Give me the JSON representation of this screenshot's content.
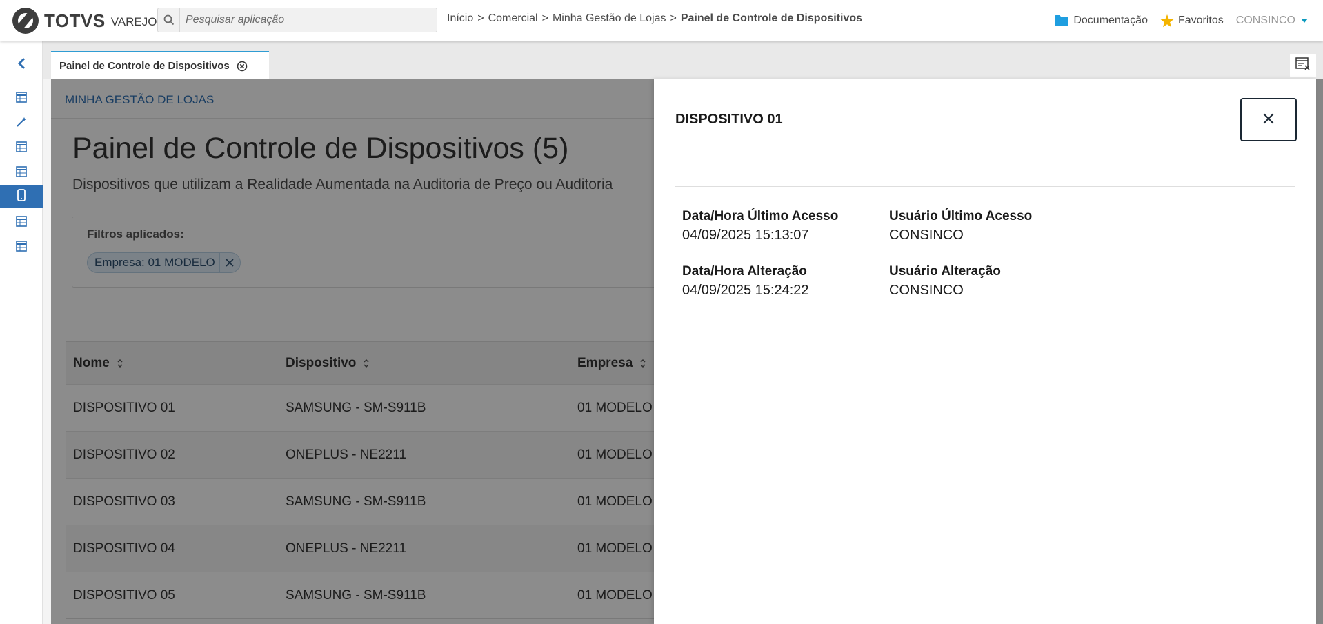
{
  "header": {
    "brand": "TOTVS",
    "product": "VAREJO",
    "search_placeholder": "Pesquisar aplicação",
    "breadcrumb": [
      "Início",
      "Comercial",
      "Minha Gestão de Lojas",
      "Painel de Controle de Dispositivos"
    ],
    "breadcrumb_separator": ">",
    "documentation_label": "Documentação",
    "favorites_label": "Favoritos",
    "user_label": "CONSINCO"
  },
  "sidebar": {
    "items": [
      {
        "icon": "chevron-left-icon"
      },
      {
        "icon": "table-icon"
      },
      {
        "icon": "wand-icon"
      },
      {
        "icon": "table-icon"
      },
      {
        "icon": "table-icon"
      },
      {
        "icon": "mobile-icon",
        "active": true
      },
      {
        "icon": "table-icon"
      },
      {
        "icon": "table-icon"
      }
    ]
  },
  "tabs": [
    {
      "label": "Painel de Controle de Dispositivos",
      "active": true
    }
  ],
  "page": {
    "section": "MINHA GESTÃO DE LOJAS",
    "title": "Painel de Controle de Dispositivos (5)",
    "subtitle": "Dispositivos que utilizam a Realidade Aumentada na Auditoria de Preço ou Auditoria",
    "filters_title": "Filtros aplicados:",
    "filter_chip": "Empresa: 01 MODELO"
  },
  "table": {
    "columns": [
      "Nome",
      "Dispositivo",
      "Empresa"
    ],
    "rows": [
      [
        "DISPOSITIVO 01",
        "SAMSUNG - SM-S911B",
        "01 MODELO"
      ],
      [
        "DISPOSITIVO 02",
        "ONEPLUS - NE2211",
        "01 MODELO"
      ],
      [
        "DISPOSITIVO 03",
        "SAMSUNG - SM-S911B",
        "01 MODELO"
      ],
      [
        "DISPOSITIVO 04",
        "ONEPLUS - NE2211",
        "01 MODELO"
      ],
      [
        "DISPOSITIVO 05",
        "SAMSUNG - SM-S911B",
        "01 MODELO"
      ]
    ]
  },
  "drawer": {
    "title": "DISPOSITIVO 01",
    "fields": [
      {
        "label": "Data/Hora Último Acesso",
        "value": "04/09/2025 15:13:07"
      },
      {
        "label": "Usuário Último Acesso",
        "value": "CONSINCO"
      },
      {
        "label": "Data/Hora Alteração",
        "value": "04/09/2025 15:24:22"
      },
      {
        "label": "Usuário Alteração",
        "value": "CONSINCO"
      }
    ]
  },
  "colors": {
    "accent": "#2f6fb3",
    "tab_accent": "#2f9cd3",
    "folder": "#1f9ee0",
    "star": "#f4b400",
    "caret": "#0c9abe"
  }
}
